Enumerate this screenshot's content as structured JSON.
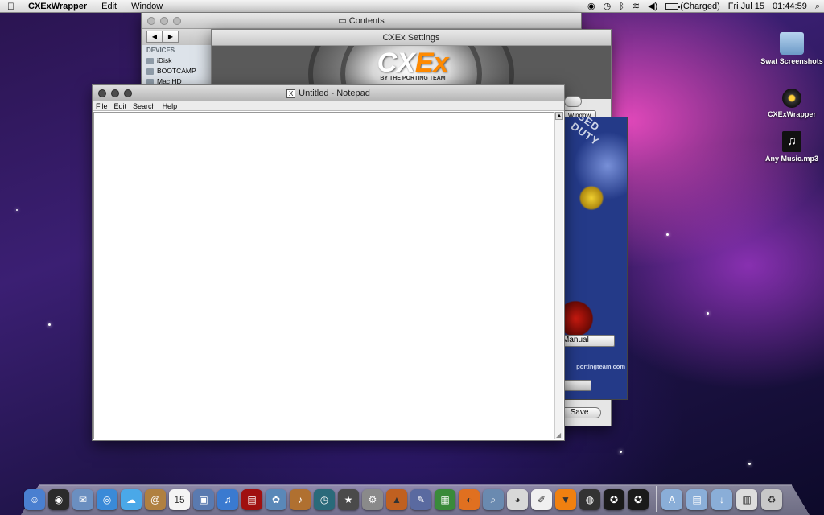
{
  "menubar": {
    "apple": "",
    "app_name": "CXExWrapper",
    "menus": [
      "Edit",
      "Window"
    ],
    "status": {
      "battery": "(Charged)",
      "date": "Fri Jul 15",
      "time": "01:44:59"
    }
  },
  "finder": {
    "title": "Contents",
    "devices_header": "DEVICES",
    "devices": [
      "iDisk",
      "BOOTCAMP",
      "Mac HD"
    ]
  },
  "cxex": {
    "title": "CXEx Settings",
    "logo_cx": "CX",
    "logo_ex": "Ex",
    "logo_by": "BY THE PORTING TEAM",
    "manual_button": "Manual",
    "save_button": "Save",
    "window_button": "Window",
    "url": "portingteam.com",
    "art_text": "SED DUTY"
  },
  "notepad": {
    "title": "Untitled - Notepad",
    "menu": [
      "File",
      "Edit",
      "Search",
      "Help"
    ],
    "content": ""
  },
  "desktop": {
    "icons": [
      {
        "label": "Swat Screenshots"
      },
      {
        "label": "CXExWrapper"
      },
      {
        "label": "Any Music.mp3"
      }
    ]
  },
  "dock": {
    "items": [
      {
        "name": "finder",
        "color": "#4a7fd0",
        "glyph": "☺"
      },
      {
        "name": "dashboard",
        "color": "#2b2b2b",
        "glyph": "◉"
      },
      {
        "name": "mail",
        "color": "#6b8fc0",
        "glyph": "✉"
      },
      {
        "name": "safari",
        "color": "#3a8ad8",
        "glyph": "◎"
      },
      {
        "name": "ichat",
        "color": "#4aa8e8",
        "glyph": "☁"
      },
      {
        "name": "address-book",
        "color": "#b08040",
        "glyph": "@"
      },
      {
        "name": "ical",
        "color": "#f4f4f4",
        "glyph": "15"
      },
      {
        "name": "preview",
        "color": "#5a7ab0",
        "glyph": "▣"
      },
      {
        "name": "itunes",
        "color": "#3a7ad0",
        "glyph": "♫"
      },
      {
        "name": "photobooth",
        "color": "#a01010",
        "glyph": "▤"
      },
      {
        "name": "iphoto",
        "color": "#5a88b8",
        "glyph": "✿"
      },
      {
        "name": "garageband",
        "color": "#b07030",
        "glyph": "♪"
      },
      {
        "name": "time-machine",
        "color": "#2a6a7a",
        "glyph": "◷"
      },
      {
        "name": "imovie",
        "color": "#4a4a4a",
        "glyph": "★"
      },
      {
        "name": "system-preferences",
        "color": "#8a8a8a",
        "glyph": "⚙"
      },
      {
        "name": "keynote",
        "color": "#c06020",
        "glyph": "▲"
      },
      {
        "name": "pages",
        "color": "#5a6aa0",
        "glyph": "✎"
      },
      {
        "name": "numbers",
        "color": "#3a8a3a",
        "glyph": "▦"
      },
      {
        "name": "firefox",
        "color": "#e07020",
        "glyph": "◐"
      },
      {
        "name": "spotlight",
        "color": "#6a8ab0",
        "glyph": "⌕"
      },
      {
        "name": "chrome",
        "color": "#d8d8d8",
        "glyph": "◕"
      },
      {
        "name": "textedit",
        "color": "#f0f0f0",
        "glyph": "✐"
      },
      {
        "name": "vlc",
        "color": "#f08010",
        "glyph": "▼"
      },
      {
        "name": "activity-monitor",
        "color": "#333333",
        "glyph": "◍"
      },
      {
        "name": "swat-1",
        "color": "#1a1a1a",
        "glyph": "✪"
      },
      {
        "name": "swat-2",
        "color": "#1a1a1a",
        "glyph": "✪"
      }
    ],
    "right_items": [
      {
        "name": "applications-folder",
        "color": "#8aaed8",
        "glyph": "A"
      },
      {
        "name": "documents-folder",
        "color": "#8aaed8",
        "glyph": "▤"
      },
      {
        "name": "downloads-folder",
        "color": "#8aaed8",
        "glyph": "↓"
      },
      {
        "name": "stack",
        "color": "#dddddd",
        "glyph": "▥"
      },
      {
        "name": "trash",
        "color": "#c8c8c8",
        "glyph": "♻"
      }
    ]
  }
}
